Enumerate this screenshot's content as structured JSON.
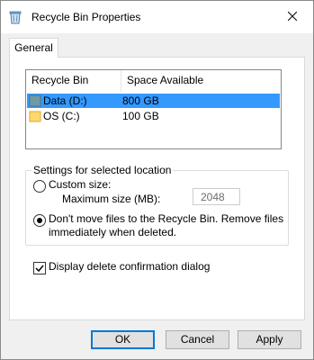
{
  "window": {
    "title": "Recycle Bin Properties"
  },
  "tabs": [
    {
      "label": "General"
    }
  ],
  "list": {
    "columns": [
      "Recycle Bin Location",
      "Space Available"
    ],
    "rows": [
      {
        "name": "Data (D:)",
        "space": "800 GB",
        "selected": true
      },
      {
        "name": "OS (C:)",
        "space": "100 GB",
        "selected": false
      }
    ]
  },
  "settings": {
    "group_label": "Settings for selected location",
    "custom_size_label": "Custom size:",
    "max_size_label": "Maximum size (MB):",
    "max_size_value": "2048",
    "dont_move_line1": "Don't move files to the Recycle Bin. Remove files",
    "dont_move_line2": "immediately when deleted.",
    "selected_option": "dont_move"
  },
  "confirm": {
    "label": "Display delete confirmation dialog",
    "checked": true
  },
  "buttons": {
    "ok": "OK",
    "cancel": "Cancel",
    "apply": "Apply"
  },
  "colors": {
    "selection": "#3399ff",
    "accent": "#0078d7",
    "drive_data": "#6f9aa5",
    "drive_os": "#ffd86b"
  }
}
